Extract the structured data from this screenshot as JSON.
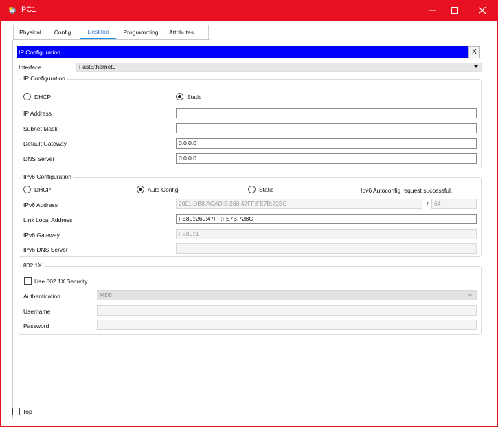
{
  "window": {
    "title": "PC1",
    "accent": "#e81123",
    "controls": {
      "minimize": "minimize-icon",
      "maximize": "maximize-icon",
      "close": "close-icon"
    }
  },
  "tabs": [
    {
      "label": "Physical"
    },
    {
      "label": "Config"
    },
    {
      "label": "Desktop",
      "active": true
    },
    {
      "label": "Programming"
    },
    {
      "label": "Attributes"
    }
  ],
  "ip_config": {
    "header": "IP Configuration",
    "close_label": "X",
    "header_color": "#0000ff",
    "interface_label": "Interface",
    "interface_value": "FastEthernet0",
    "ipv4": {
      "group_title": "IP Configuration",
      "dhcp_label": "DHCP",
      "static_label": "Static",
      "selected": "Static",
      "ip_address_label": "IP Address",
      "ip_address_value": "",
      "subnet_mask_label": "Subnet Mask",
      "subnet_mask_value": "",
      "gateway_label": "Default Gateway",
      "gateway_value": "0.0.0.0",
      "dns_label": "DNS Server",
      "dns_value": "0.0.0.0"
    },
    "ipv6": {
      "group_title": "IPv6 Configuration",
      "dhcp_label": "DHCP",
      "auto_label": "Auto Config",
      "static_label": "Static",
      "selected": "Auto Config",
      "status": "Ipv6 Autoconfig request successful.",
      "address_label": "IPv6 Address",
      "address_value": "2001:DB8:ACAD:B:260:47FF:FE7B:72BC",
      "prefix_sep": "/",
      "prefix_value": "64",
      "link_local_label": "Link Local Address",
      "link_local_value": "FE80::260:47FF:FE7B:72BC",
      "gateway_label": "IPv6 Gateway",
      "gateway_value": "FE80::1",
      "dns_label": "IPv6 DNS Server",
      "dns_value": ""
    },
    "dot1x": {
      "group_title": "802.1X",
      "use_label": "Use 802.1X Security",
      "use_checked": false,
      "auth_label": "Authentication",
      "auth_value": "MD5",
      "username_label": "Username",
      "username_value": "",
      "password_label": "Password",
      "password_value": ""
    }
  },
  "footer": {
    "top_label": "Top",
    "top_checked": false
  }
}
